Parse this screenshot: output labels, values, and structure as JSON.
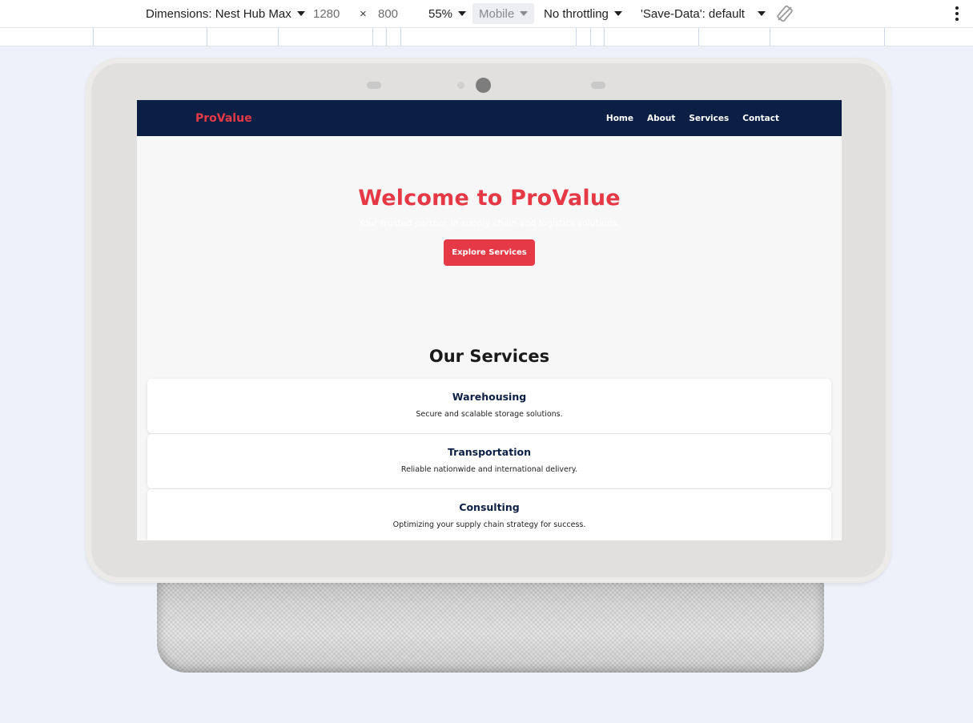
{
  "devtools": {
    "dimensions_label": "Dimensions: Nest Hub Max",
    "width": "1280",
    "times": "×",
    "height": "800",
    "zoom": "55%",
    "device_type": "Mobile",
    "throttling": "No throttling",
    "save_data": "'Save-Data': default",
    "icons": [
      "caret-down-icon",
      "rotate-icon",
      "more-options-icon"
    ]
  },
  "site": {
    "brand": "ProValue",
    "nav": {
      "home": "Home",
      "about": "About",
      "services": "Services",
      "contact": "Contact"
    },
    "hero": {
      "title": "Welcome to ProValue",
      "subtitle": "Your trusted partner in supply chain and logistics solutions.",
      "cta": "Explore Services"
    },
    "services": {
      "heading": "Our Services",
      "items": [
        {
          "title": "Warehousing",
          "desc": "Secure and scalable storage solutions."
        },
        {
          "title": "Transportation",
          "desc": "Reliable nationwide and international delivery."
        },
        {
          "title": "Consulting",
          "desc": "Optimizing your supply chain strategy for success."
        }
      ]
    }
  },
  "colors": {
    "nav_bg": "#0b1f44",
    "accent": "#e63946",
    "page_bg": "#eef1f9",
    "screen_bg": "#f7f7f7"
  }
}
